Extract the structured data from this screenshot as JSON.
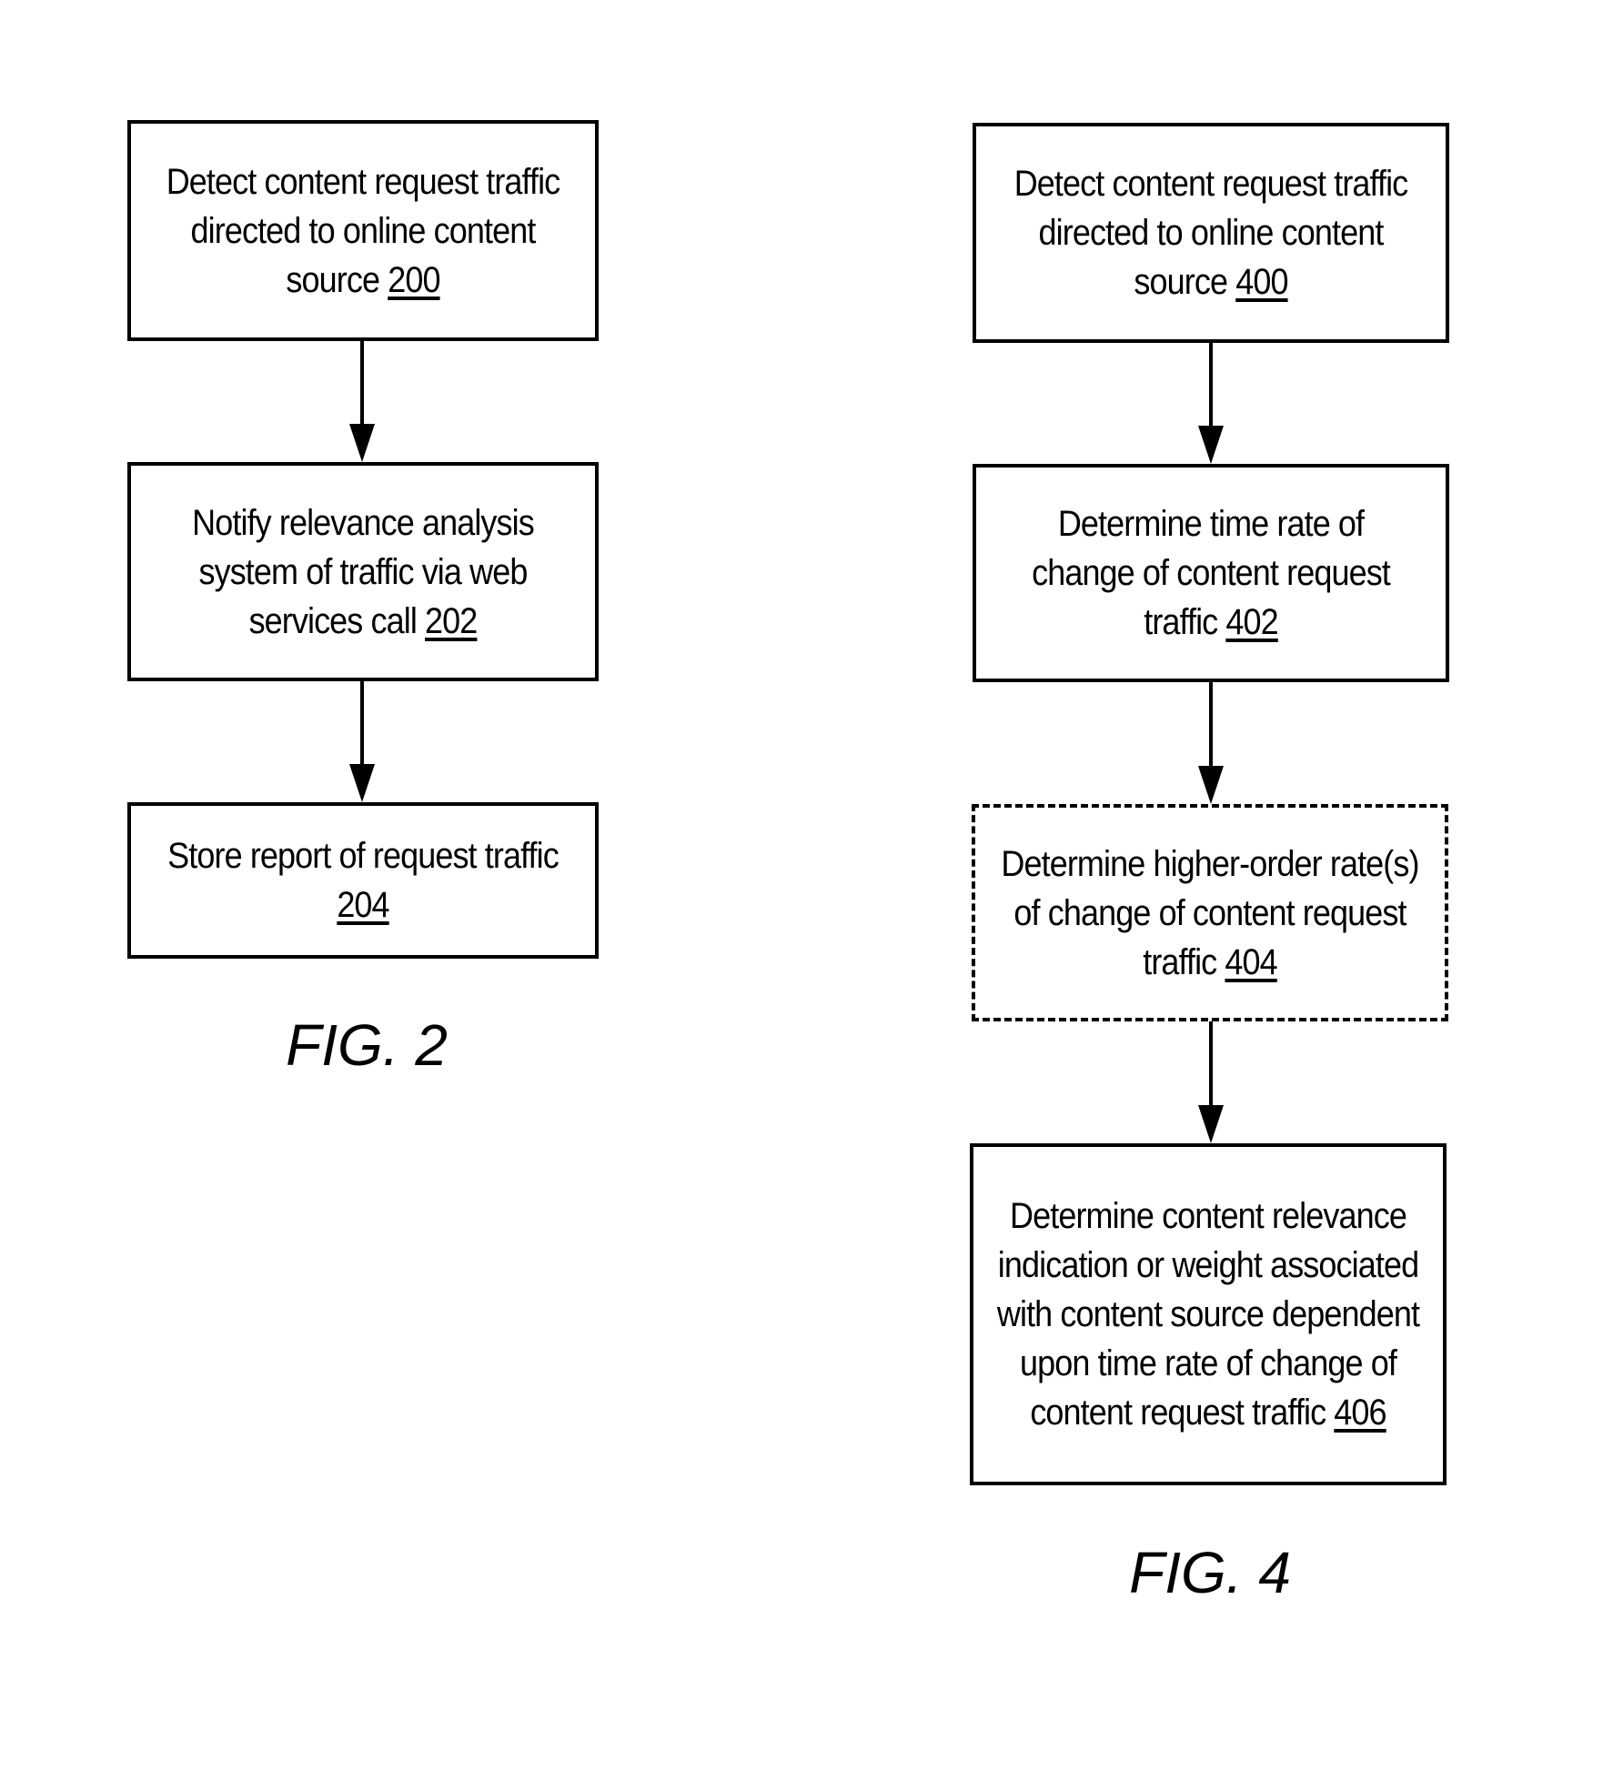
{
  "figures": [
    {
      "label": "FIG. 2",
      "steps": [
        {
          "text": "Detect content request traffic directed to online content source",
          "ref": "200",
          "style": "solid"
        },
        {
          "text": "Notify relevance analysis system of traffic via web services call",
          "ref": "202",
          "style": "solid"
        },
        {
          "text": "Store report of request traffic",
          "ref": "204",
          "style": "solid"
        }
      ],
      "edges": [
        [
          "200",
          "202"
        ],
        [
          "202",
          "204"
        ]
      ]
    },
    {
      "label": "FIG. 4",
      "steps": [
        {
          "text": "Detect content request traffic directed to online content source",
          "ref": "400",
          "style": "solid"
        },
        {
          "text": "Determine time rate of change of content request traffic",
          "ref": "402",
          "style": "solid"
        },
        {
          "text": "Determine higher-order rate(s) of change of content request traffic",
          "ref": "404",
          "style": "dashed (optional)"
        },
        {
          "text": "Determine content relevance indication or weight associated with content source dependent upon time rate of change of content request traffic",
          "ref": "406",
          "style": "solid"
        }
      ],
      "edges": [
        [
          "400",
          "402"
        ],
        [
          "402",
          "404"
        ],
        [
          "404",
          "406"
        ]
      ]
    }
  ]
}
